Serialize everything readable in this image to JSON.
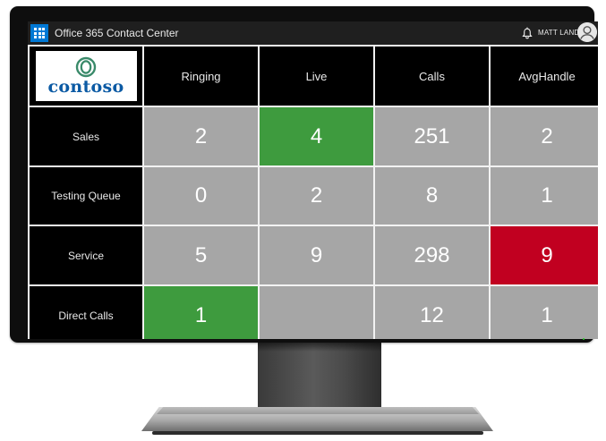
{
  "app": {
    "title": "Office 365 Contact Center",
    "user_name": "MATT LANDIS"
  },
  "icons": {
    "app_launcher": "waffle-icon",
    "notifications": "bell-icon",
    "user": "user-avatar-icon"
  },
  "logo": {
    "text": "contoso"
  },
  "colors": {
    "header_bg": "#000000",
    "cell_default": "#a6a6a6",
    "cell_green": "#3e9b3e",
    "cell_red": "#c10020",
    "launcher_blue": "#0078d4",
    "logo_blue": "#0b5aa4",
    "logo_green": "#3a8a6a"
  },
  "columns": [
    "Ringing",
    "Live",
    "Calls",
    "AvgHandle"
  ],
  "rows": [
    {
      "label": "Sales",
      "values": [
        "2",
        "4",
        "251",
        "2"
      ],
      "status": [
        "default",
        "green",
        "default",
        "default"
      ]
    },
    {
      "label": "Testing Queue",
      "values": [
        "0",
        "2",
        "8",
        "1"
      ],
      "status": [
        "default",
        "default",
        "default",
        "default"
      ]
    },
    {
      "label": "Service",
      "values": [
        "5",
        "9",
        "298",
        "9"
      ],
      "status": [
        "default",
        "default",
        "default",
        "red"
      ]
    },
    {
      "label": "Direct Calls",
      "values": [
        "1",
        "",
        "12",
        "1"
      ],
      "status": [
        "green",
        "default",
        "default",
        "default"
      ]
    }
  ]
}
